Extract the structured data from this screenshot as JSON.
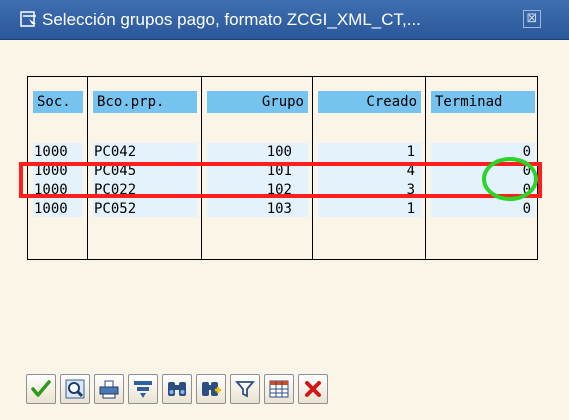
{
  "window": {
    "title": "Selección grupos pago, formato ZCGI_XML_CT,...",
    "close_glyph": "⊠"
  },
  "table": {
    "columns": [
      "Soc.",
      "Bco.prp.",
      "Grupo",
      "Creado",
      "Terminad"
    ],
    "rows": [
      {
        "soc": "1000",
        "bco": "PC042",
        "grupo": "100",
        "creado": "1",
        "terminad": "0"
      },
      {
        "soc": "1000",
        "bco": "PC045",
        "grupo": "101",
        "creado": "4",
        "terminad": "0"
      },
      {
        "soc": "1000",
        "bco": "PC022",
        "grupo": "102",
        "creado": "3",
        "terminad": "0"
      },
      {
        "soc": "1000",
        "bco": "PC052",
        "grupo": "103",
        "creado": "1",
        "terminad": "0"
      }
    ]
  },
  "annotations": {
    "highlight_row_color": "#ff1e1e",
    "highlight_cell_color": "#2ad52a"
  },
  "toolbar": {
    "buttons": [
      {
        "icon": "checkmark-icon"
      },
      {
        "icon": "detail-search-icon"
      },
      {
        "icon": "print-icon"
      },
      {
        "icon": "sort-icon"
      },
      {
        "icon": "find-icon"
      },
      {
        "icon": "find-next-icon"
      },
      {
        "icon": "filter-icon"
      },
      {
        "icon": "layout-grid-icon"
      },
      {
        "icon": "cancel-icon"
      }
    ]
  }
}
